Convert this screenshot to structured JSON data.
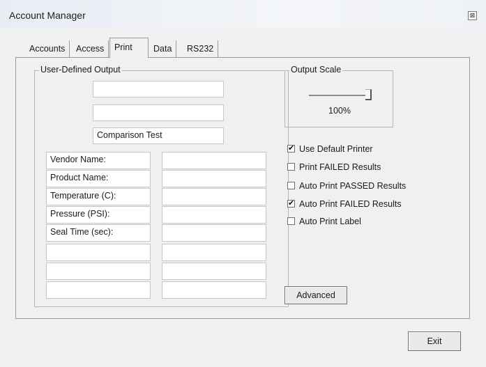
{
  "window": {
    "title": "Account Manager",
    "close_glyph": "⊠"
  },
  "tabs": [
    {
      "label": "Accounts",
      "active": false
    },
    {
      "label": "Access",
      "active": false
    },
    {
      "label": "Print",
      "active": true
    },
    {
      "label": "Data",
      "active": false
    },
    {
      "label": "RS232",
      "active": false
    }
  ],
  "output": {
    "group_label": "User-Defined Output",
    "header_fields": [
      "",
      "",
      "Comparison Test"
    ],
    "rows": [
      {
        "label": "Vendor Name:",
        "value": ""
      },
      {
        "label": "Product Name:",
        "value": ""
      },
      {
        "label": "Temperature (C):",
        "value": ""
      },
      {
        "label": "Pressure (PSI):",
        "value": ""
      },
      {
        "label": "Seal Time (sec):",
        "value": ""
      },
      {
        "label": "",
        "value": ""
      },
      {
        "label": "",
        "value": ""
      },
      {
        "label": "",
        "value": ""
      }
    ]
  },
  "scale": {
    "group_label": "Output Scale",
    "value_label": "100%",
    "level": 1.0
  },
  "options": [
    {
      "label": "Use Default Printer",
      "checked": true
    },
    {
      "label": "Print FAILED Results",
      "checked": false
    },
    {
      "label": "Auto Print PASSED Results",
      "checked": false
    },
    {
      "label": "Auto Print FAILED Results",
      "checked": true
    },
    {
      "label": "Auto Print Label",
      "checked": false
    }
  ],
  "buttons": {
    "advanced": "Advanced",
    "exit": "Exit"
  },
  "glyphs": {
    "check": "✔"
  }
}
